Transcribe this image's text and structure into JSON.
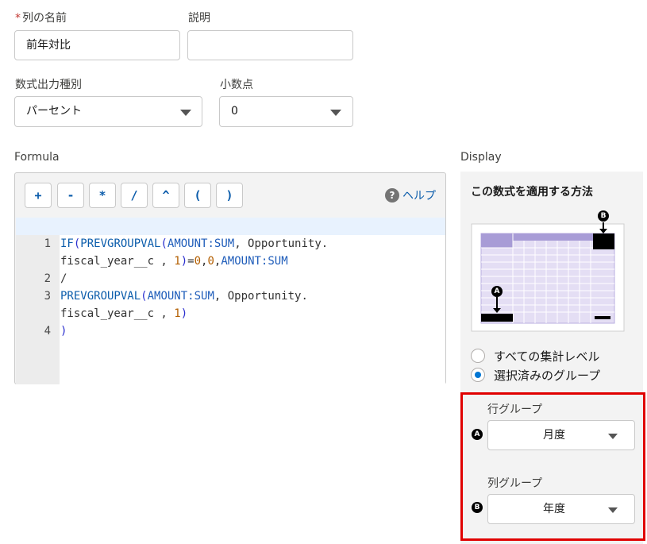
{
  "fields": {
    "column_name": {
      "required_mark": "*",
      "label": "列の名前",
      "value": "前年対比"
    },
    "description": {
      "label": "説明",
      "value": ""
    },
    "output_type": {
      "label": "数式出力種別",
      "value": "パーセント"
    },
    "decimals": {
      "label": "小数点",
      "value": "0"
    }
  },
  "formula": {
    "label": "Formula",
    "operators": [
      "+",
      "-",
      "*",
      "/",
      "^",
      "(",
      ")"
    ],
    "help_label": "ヘルプ",
    "line_numbers": [
      "1",
      "2",
      "3",
      "4"
    ]
  },
  "display": {
    "label": "Display",
    "heading": "この数式を適用する方法",
    "diagram_badges": {
      "a": "A",
      "b": "B"
    },
    "options": [
      {
        "label": "すべての集計レベル",
        "selected": false
      },
      {
        "label": "選択済みのグループ",
        "selected": true
      }
    ],
    "row_group": {
      "label": "行グループ",
      "value": "月度",
      "badge": "A"
    },
    "col_group": {
      "label": "列グループ",
      "value": "年度",
      "badge": "B"
    }
  },
  "colors": {
    "accent": "#0176d3",
    "highlight_border": "#e00000",
    "diagram_fill": "#a89cd6"
  }
}
